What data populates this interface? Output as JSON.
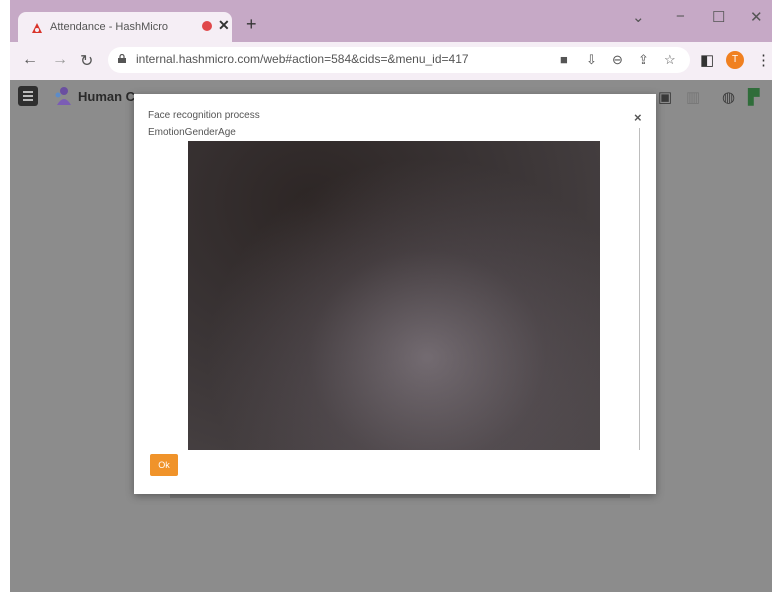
{
  "browser": {
    "tab": {
      "title": "Attendance - HashMicro",
      "close": "✕"
    },
    "new_tab": "+",
    "window_controls": {
      "dropdown": "⌄",
      "minimize": "−",
      "restore": "☐",
      "close": "✕"
    },
    "nav": {
      "back": "←",
      "forward": "→",
      "reload": "↻"
    },
    "url": "internal.hashmicro.com/web#action=584&cids=&menu_id=417",
    "profile_initial": "T",
    "icons": [
      "camera-icon",
      "install-icon",
      "zoom-icon",
      "share-icon",
      "star-icon",
      "sidepanel-icon",
      "more-icon"
    ]
  },
  "app": {
    "name": "Human C",
    "icons": [
      "activity-icon",
      "list-icon",
      "chat-icon",
      "settings-icon"
    ]
  },
  "modal": {
    "title": "Face recognition process",
    "subtitle": "EmotionGenderAge",
    "close": "×",
    "ok_label": "Ok"
  },
  "colors": {
    "tabstrip": "#c6a9c6",
    "toolbar": "#f5eef5",
    "overlay": "#8c8c8c",
    "ok_button": "#f0932a",
    "profile": "#f08020"
  }
}
